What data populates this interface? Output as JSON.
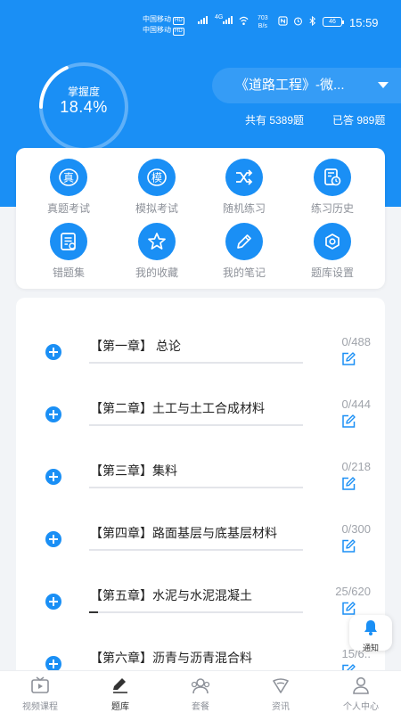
{
  "status_bar": {
    "carrier1": "中国移动",
    "carrier2": "中国移动",
    "hd": "HD",
    "net": "4G",
    "speed_value": "703",
    "speed_unit": "B/s",
    "battery": "46",
    "time": "15:59"
  },
  "mastery": {
    "label": "掌握度",
    "value": "18.4%",
    "fraction": 0.184
  },
  "subject": {
    "name": "《道路工程》-微...",
    "total": "共有 5389题",
    "answered": "已答 989题"
  },
  "functions": [
    {
      "label": "真题考试",
      "icon": "real-exam-icon",
      "glyph": "真"
    },
    {
      "label": "模拟考试",
      "icon": "mock-exam-icon",
      "glyph": "模"
    },
    {
      "label": "随机练习",
      "icon": "shuffle-icon",
      "glyph": ""
    },
    {
      "label": "练习历史",
      "icon": "history-icon",
      "glyph": ""
    },
    {
      "label": "错题集",
      "icon": "wrong-questions-icon",
      "glyph": ""
    },
    {
      "label": "我的收藏",
      "icon": "star-icon",
      "glyph": ""
    },
    {
      "label": "我的笔记",
      "icon": "pencil-icon",
      "glyph": ""
    },
    {
      "label": "题库设置",
      "icon": "settings-icon",
      "glyph": ""
    }
  ],
  "chapters": [
    {
      "title": "【第一章】 总论",
      "count": "0/488",
      "progress": 0
    },
    {
      "title": "【第二章】土工与土工合成材料",
      "count": "0/444",
      "progress": 0
    },
    {
      "title": "【第三章】集料",
      "count": "0/218",
      "progress": 0
    },
    {
      "title": "【第四章】路面基层与底基层材料",
      "count": "0/300",
      "progress": 0
    },
    {
      "title": "【第五章】水泥与水泥混凝土",
      "count": "25/620",
      "progress": 0.04
    },
    {
      "title": "【第六章】沥青与沥青混合料",
      "count": "15/6..",
      "progress": 0.02
    }
  ],
  "notify": {
    "label": "通知"
  },
  "tabs": [
    {
      "label": "视频课程",
      "icon": "video-icon",
      "active": false
    },
    {
      "label": "题库",
      "icon": "question-bank-icon",
      "active": true
    },
    {
      "label": "套餐",
      "icon": "package-icon",
      "active": false
    },
    {
      "label": "资讯",
      "icon": "news-icon",
      "active": false
    },
    {
      "label": "个人中心",
      "icon": "profile-icon",
      "active": false
    }
  ],
  "colors": {
    "primary": "#1a8ff5",
    "muted_text": "#8d9199",
    "background": "#f2f4f7"
  }
}
